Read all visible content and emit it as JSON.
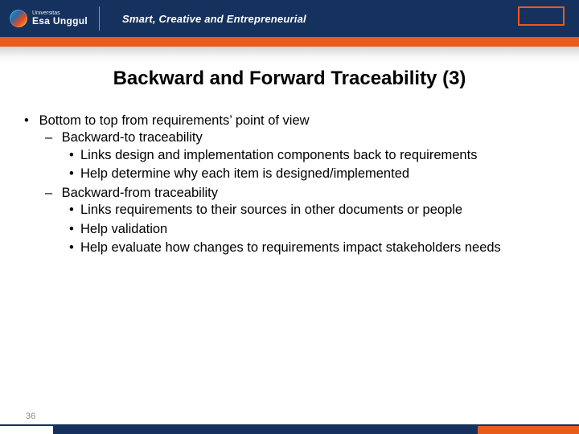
{
  "header": {
    "logo_university": "Universitas",
    "logo_name": "Esa Unggul",
    "tagline": "Smart, Creative and Entrepreneurial"
  },
  "title": "Backward and Forward Traceability (3)",
  "bullets_level1": [
    "Bottom to top from requirements’ point of view"
  ],
  "bullets_level2a": "Backward-to traceability",
  "bullets_level3a": [
    "Links design and implementation components back to requirements",
    "Help determine why each item is designed/implemented"
  ],
  "bullets_level2b": "Backward-from traceability",
  "bullets_level3b": [
    "Links requirements to their sources in other documents or people",
    "Help validation",
    "Help evaluate how changes to requirements impact stakeholders needs"
  ],
  "page_number": "36"
}
